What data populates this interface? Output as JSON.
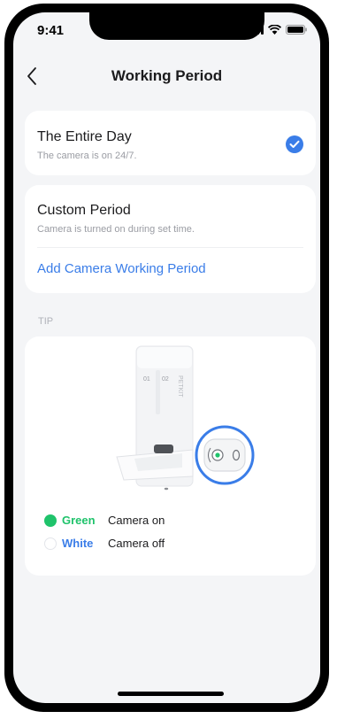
{
  "status_bar": {
    "time": "9:41"
  },
  "header": {
    "title": "Working Period"
  },
  "options": {
    "entire_day": {
      "title": "The Entire Day",
      "subtitle": "The camera is on 24/7.",
      "selected": true
    },
    "custom": {
      "title": "Custom Period",
      "subtitle": "Camera is turned on during set time.",
      "add_label": "Add Camera Working Period"
    }
  },
  "tip": {
    "label": "TIP",
    "device_brand": "PETKIT",
    "tank_labels": [
      "01",
      "02"
    ],
    "legend": [
      {
        "color_name": "Green",
        "description": "Camera on",
        "color": "#1fc36b"
      },
      {
        "color_name": "White",
        "description": "Camera off",
        "color": "#3a7de8"
      }
    ]
  },
  "colors": {
    "accent": "#3a7de8",
    "green": "#1fc36b",
    "background": "#f4f5f7"
  }
}
